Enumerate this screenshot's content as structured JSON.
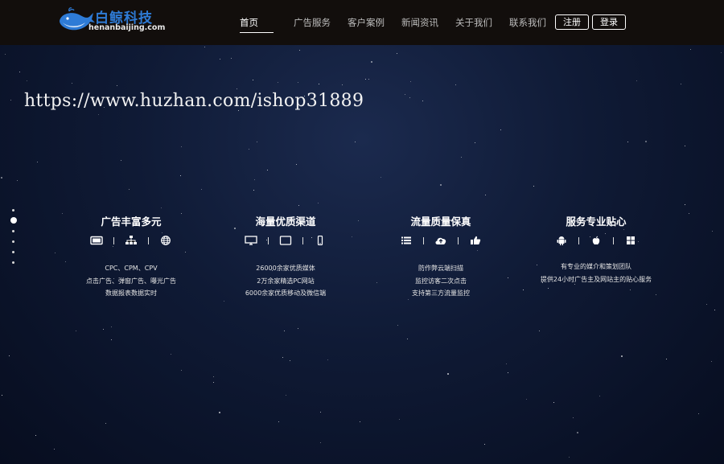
{
  "header": {
    "logo": {
      "cn": "白鲸科技",
      "en": "henanbaijing.com",
      "icon": "whale-logo"
    },
    "nav": [
      {
        "label": "首页",
        "active": true
      },
      {
        "label": "广告服务",
        "active": false
      },
      {
        "label": "客户案例",
        "active": false
      },
      {
        "label": "新闻资讯",
        "active": false
      },
      {
        "label": "关于我们",
        "active": false
      },
      {
        "label": "联系我们",
        "active": false
      }
    ],
    "register": "注册",
    "login": "登录"
  },
  "watermark": "https://www.huzhan.com/ishop31889",
  "side_nav": {
    "count": 6,
    "active_index": 1
  },
  "features": [
    {
      "title": "广告丰富多元",
      "icons": [
        "tablet-icon",
        "sitemap-icon",
        "globe-icon"
      ],
      "lines": [
        "CPC、CPM、CPV",
        "点击广告、弹窗广告、曝光广告",
        "数据报表数据实时"
      ]
    },
    {
      "title": "海量优质渠道",
      "icons": [
        "monitor-icon",
        "tablet-icon",
        "mobile-icon"
      ],
      "lines": [
        "26000余家优质媒体",
        "2万余家精选PC网站",
        "6000余家优质移动及微信端"
      ]
    },
    {
      "title": "流量质量保真",
      "icons": [
        "list-icon",
        "cloud-upload-icon",
        "thumbs-up-icon"
      ],
      "lines": [
        "防作弊云端扫描",
        "监控访客二次点击",
        "支持第三方流量监控"
      ]
    },
    {
      "title": "服务专业贴心",
      "icons": [
        "android-icon",
        "apple-icon",
        "windows-icon"
      ],
      "lines": [
        "有专业的媒介和策划团队",
        "提供24小时广告主及网站主的贴心服务"
      ]
    }
  ],
  "colors": {
    "header_bg": "#120e0c",
    "logo_blue": "#2e7bd6",
    "page_bg": "#0f1a35"
  }
}
